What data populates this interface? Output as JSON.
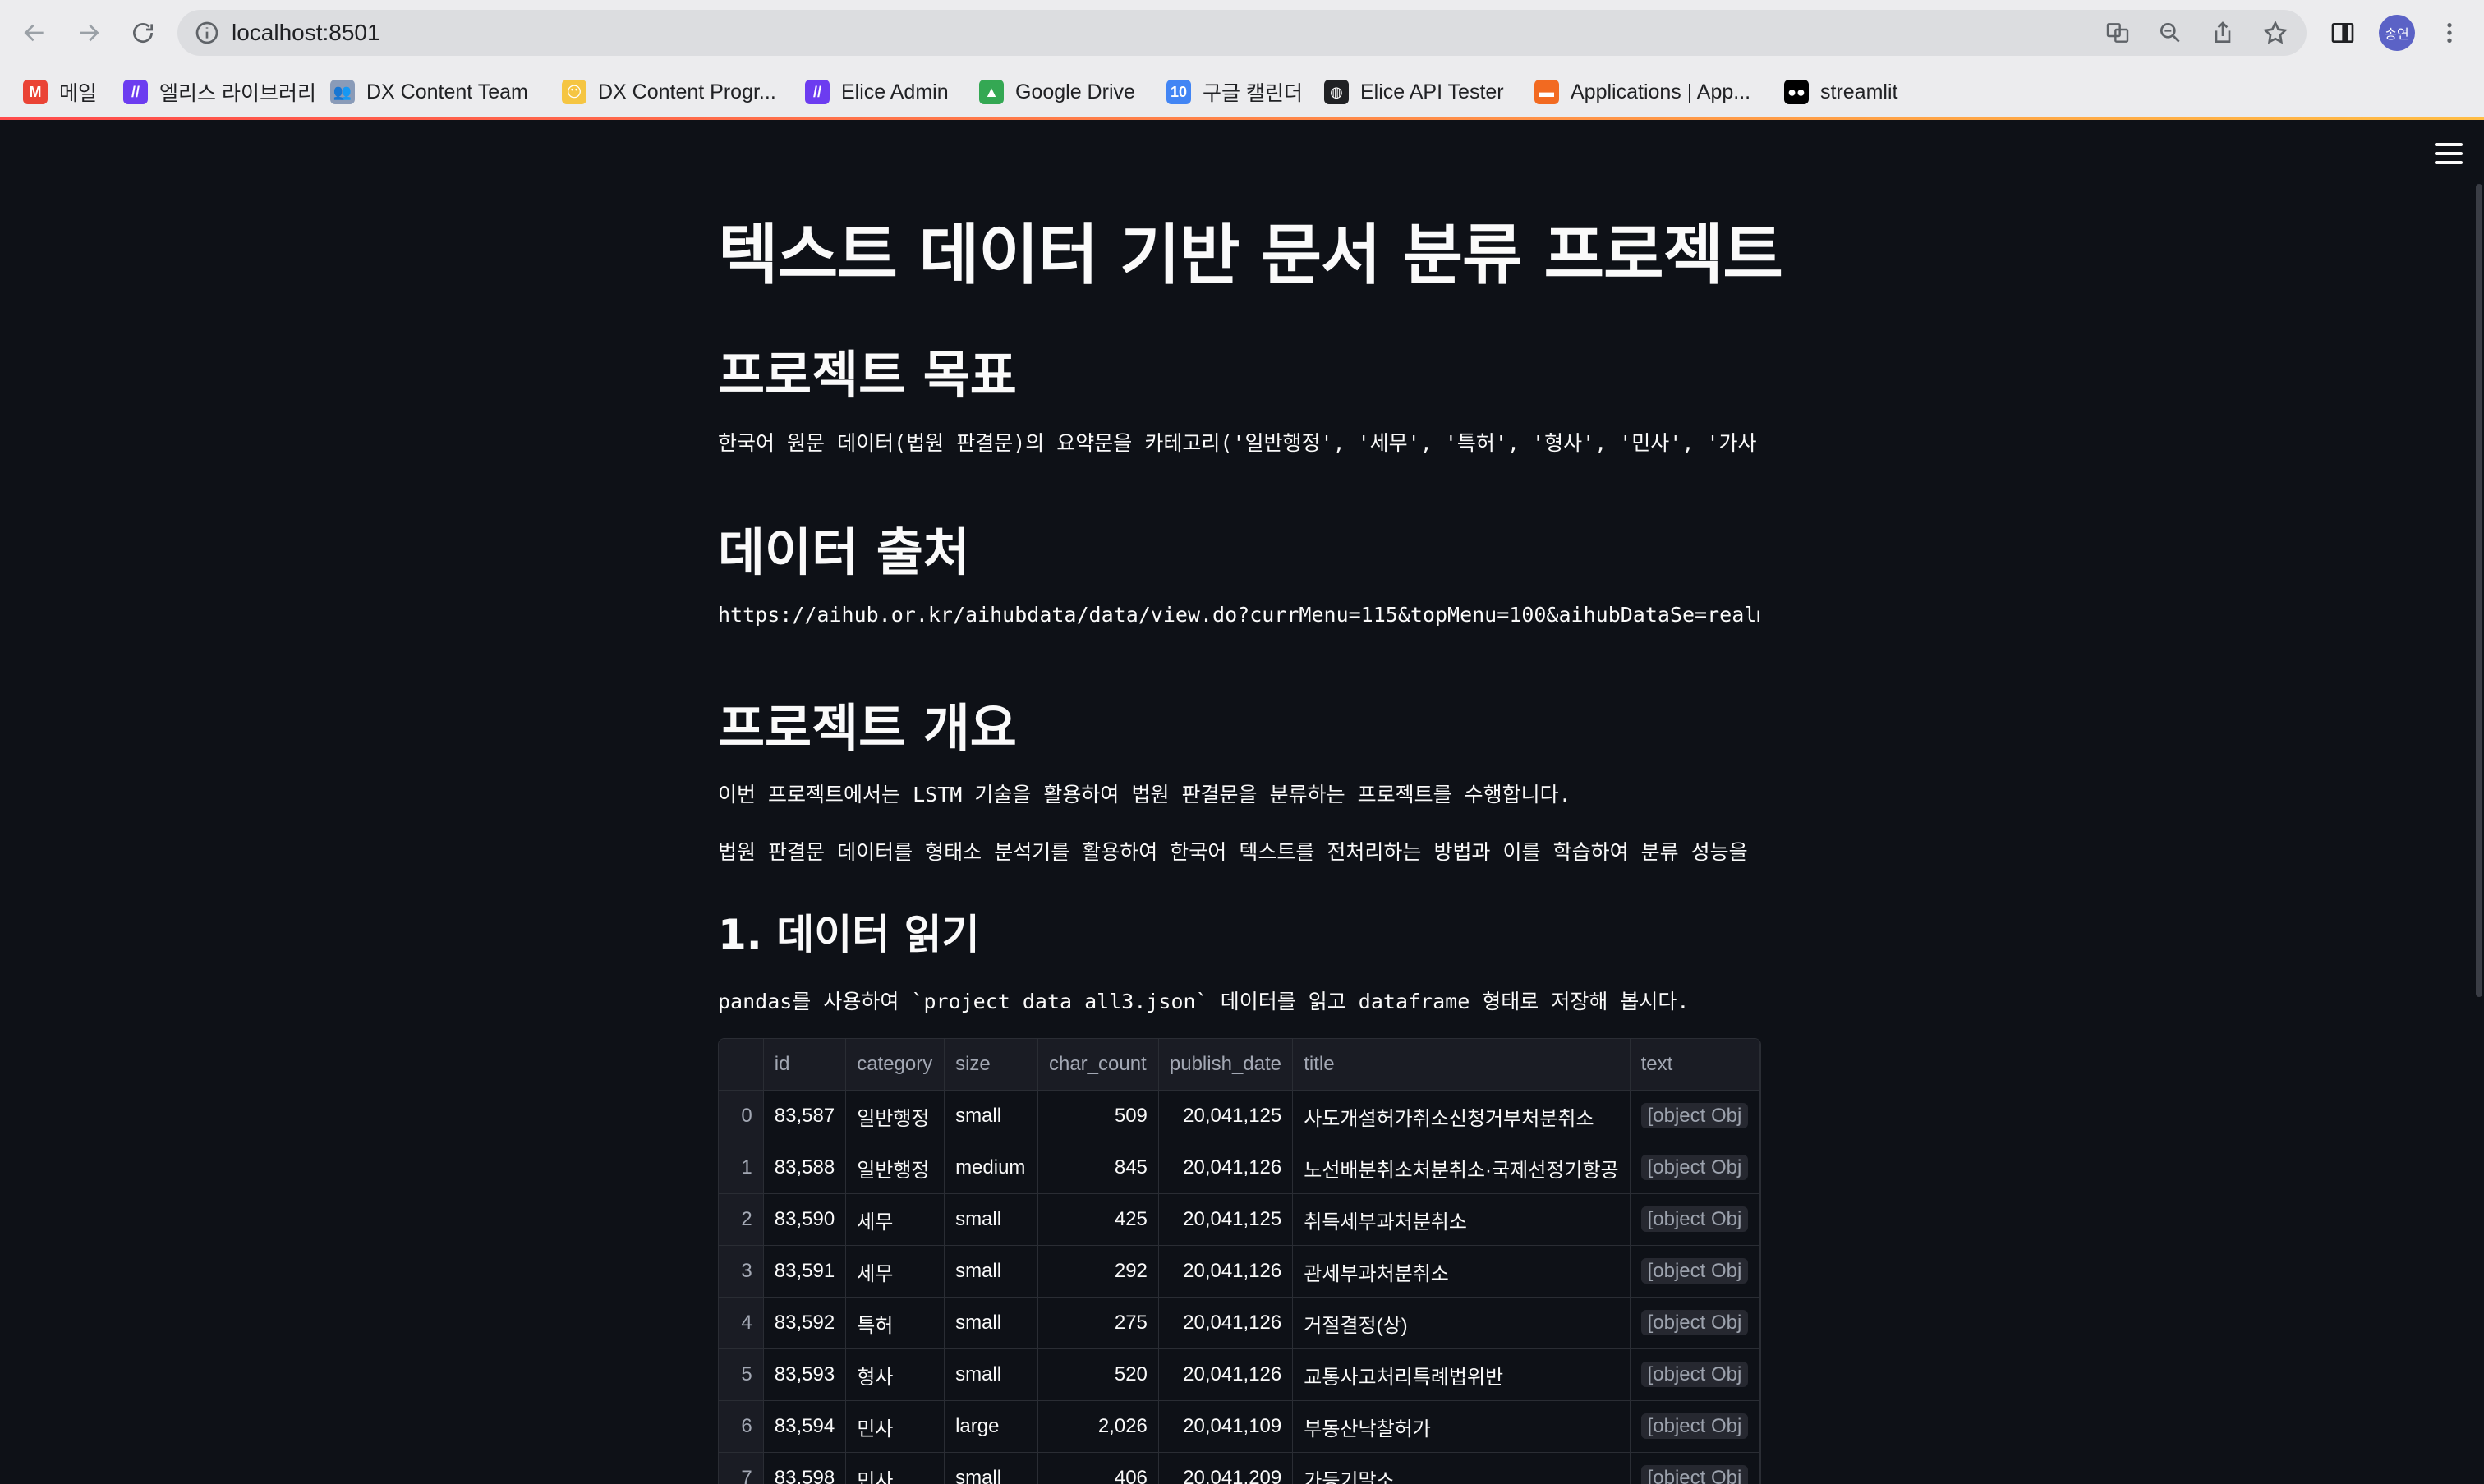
{
  "browser": {
    "url": "localhost:8501",
    "avatar_text": "송연",
    "bookmarks": [
      {
        "label": "메일",
        "icon": "gmail-icon",
        "color": "#ea4335",
        "glyph": "M"
      },
      {
        "label": "엘리스 라이브러리",
        "icon": "elice-icon",
        "color": "#6c3cf0",
        "glyph": "//"
      },
      {
        "label": "DX Content Team",
        "icon": "people-icon",
        "color": "#8a9bb8",
        "glyph": "👥"
      },
      {
        "label": "DX Content Progr...",
        "icon": "emoji-icon",
        "color": "#f5c542",
        "glyph": "😶"
      },
      {
        "label": "Elice Admin",
        "icon": "elice-icon",
        "color": "#6c3cf0",
        "glyph": "//"
      },
      {
        "label": "Google Drive",
        "icon": "drive-icon",
        "color": "#34a853",
        "glyph": "▲"
      },
      {
        "label": "구글 캘린더",
        "icon": "calendar-icon",
        "color": "#4285f4",
        "glyph": "10"
      },
      {
        "label": "Elice API Tester",
        "icon": "globe-icon",
        "color": "#202124",
        "glyph": "◍"
      },
      {
        "label": "Applications | App...",
        "icon": "app-icon",
        "color": "#f26a21",
        "glyph": "▬"
      },
      {
        "label": "streamlit",
        "icon": "medium-icon",
        "color": "#000000",
        "glyph": "●●"
      }
    ]
  },
  "page": {
    "title": "텍스트 데이터 기반 문서 분류 프로젝트",
    "sections": {
      "goal_heading": "프로젝트 목표",
      "goal_text": "한국어 원문 데이터(법원 판결문)의 요약문을 카테고리('일반행정', '세무', '특허', '형사', '민사', '가사')별",
      "source_heading": "데이터 출처",
      "source_text": "https://aihub.or.kr/aihubdata/data/view.do?currMenu=115&topMenu=100&aihubDataSe=realm",
      "overview_heading": "프로젝트 개요",
      "overview_text1": "이번 프로젝트에서는 LSTM 기술을 활용하여 법원 판결문을 분류하는 프로젝트를 수행합니다.",
      "overview_text2": "법원 판결문 데이터를 형태소 분석기를 활용하여 한국어 텍스트를 전처리하는 방법과 이를 학습하여 분류 성능을 확인해",
      "step1_heading": "1. 데이터 읽기",
      "step1_text": "pandas를 사용하여 `project_data_all3.json` 데이터를 읽고 dataframe 형태로 저장해 봅시다."
    }
  },
  "dataframe": {
    "columns": [
      "",
      "id",
      "category",
      "size",
      "char_count",
      "publish_date",
      "title",
      "text"
    ],
    "rows": [
      [
        "0",
        "83,587",
        "일반행정",
        "small",
        "509",
        "20,041,125",
        "사도개설허가취소신청거부처분취소",
        "[object Obj"
      ],
      [
        "1",
        "83,588",
        "일반행정",
        "medium",
        "845",
        "20,041,126",
        "노선배분취소처분취소·국제선정기항공",
        "[object Obj"
      ],
      [
        "2",
        "83,590",
        "세무",
        "small",
        "425",
        "20,041,125",
        "취득세부과처분취소",
        "[object Obj"
      ],
      [
        "3",
        "83,591",
        "세무",
        "small",
        "292",
        "20,041,126",
        "관세부과처분취소",
        "[object Obj"
      ],
      [
        "4",
        "83,592",
        "특허",
        "small",
        "275",
        "20,041,126",
        "거절결정(상)",
        "[object Obj"
      ],
      [
        "5",
        "83,593",
        "형사",
        "small",
        "520",
        "20,041,126",
        "교통사고처리특례법위반",
        "[object Obj"
      ],
      [
        "6",
        "83,594",
        "민사",
        "large",
        "2,026",
        "20,041,109",
        "부동산낙찰허가",
        "[object Obj"
      ],
      [
        "7",
        "83,598",
        "민사",
        "small",
        "406",
        "20,041,209",
        "가등기말소",
        "[object Obj"
      ]
    ]
  }
}
